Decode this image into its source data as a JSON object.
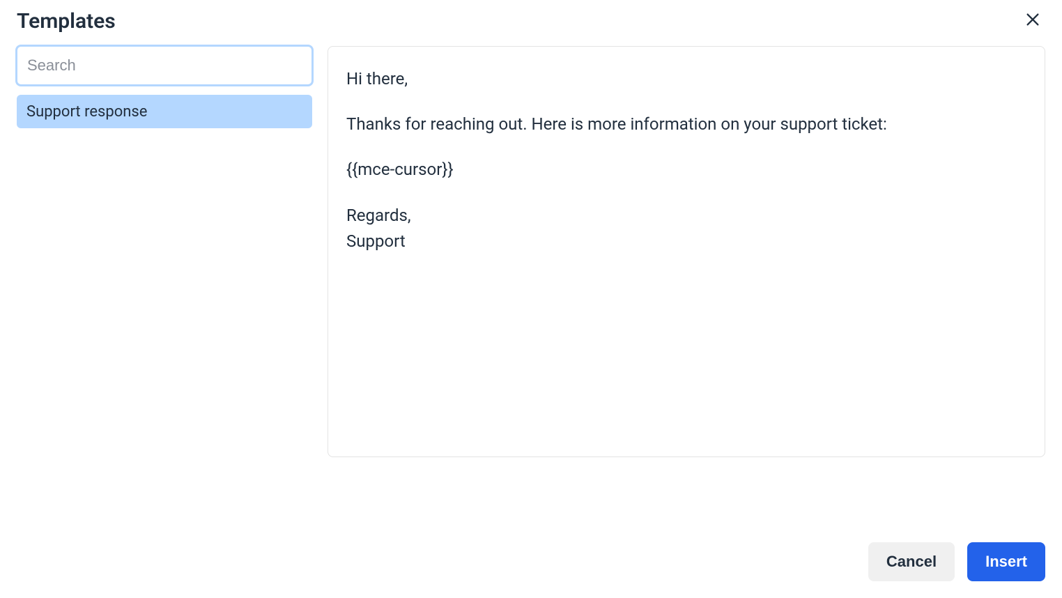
{
  "header": {
    "title": "Templates"
  },
  "search": {
    "placeholder": "Search",
    "value": ""
  },
  "templates": {
    "items": [
      {
        "label": "Support response",
        "selected": true
      }
    ]
  },
  "preview": {
    "paragraphs": [
      "Hi there,",
      "Thanks for reaching out. Here is more information on your support ticket:",
      "{{mce-cursor}}",
      "Regards,\nSupport"
    ]
  },
  "footer": {
    "cancel_label": "Cancel",
    "insert_label": "Insert"
  }
}
